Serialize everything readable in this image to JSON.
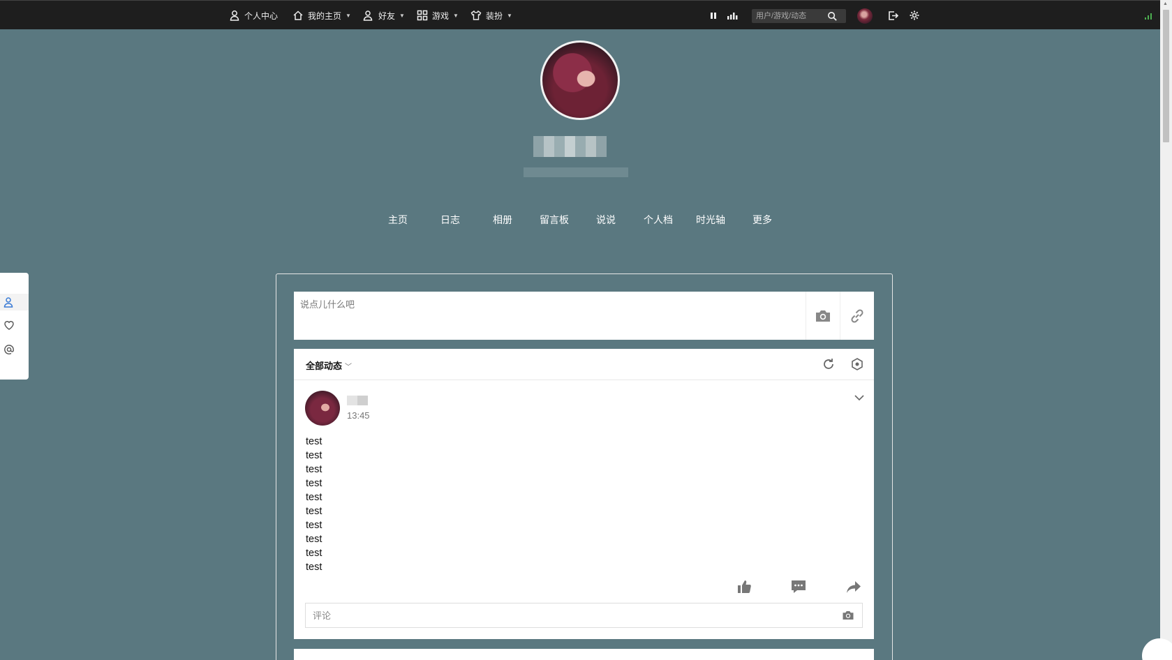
{
  "topnav": {
    "items": [
      {
        "label": "个人中心",
        "icon": "user-icon",
        "has_caret": false
      },
      {
        "label": "我的主页",
        "icon": "home-icon",
        "has_caret": true
      },
      {
        "label": "好友",
        "icon": "friends-icon",
        "has_caret": true
      },
      {
        "label": "游戏",
        "icon": "grid-icon",
        "has_caret": true
      },
      {
        "label": "装扮",
        "icon": "shirt-icon",
        "has_caret": true
      }
    ],
    "search_placeholder": "用户/游戏/动态"
  },
  "profile": {
    "tabs": [
      "主页",
      "日志",
      "相册",
      "留言板",
      "说说",
      "个人档",
      "时光轴",
      "更多"
    ]
  },
  "composer": {
    "placeholder": "说点儿什么吧",
    "buttons": [
      "camera-icon",
      "link-icon"
    ]
  },
  "feed": {
    "title": "全部动态",
    "post": {
      "time": "13:45",
      "lines": [
        "test",
        "test",
        "test",
        "test",
        "test",
        "test",
        "test",
        "test",
        "test",
        "test"
      ],
      "comment_placeholder": "评论"
    }
  },
  "colors": {
    "page_bg": "#5a7880",
    "topbar_bg": "#1e1e1e",
    "accent_green": "#4caf50",
    "side_accent": "#3a7bd5"
  }
}
